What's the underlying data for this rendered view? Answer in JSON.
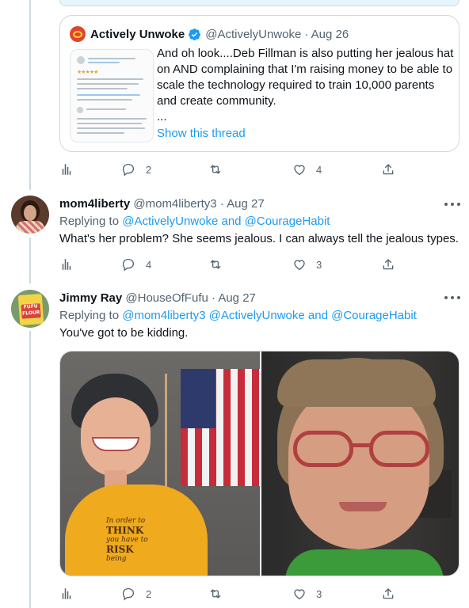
{
  "quoted": {
    "name": "Actively Unwoke",
    "handle": "@ActivelyUnwoke",
    "date": "· Aug 26",
    "text": "And oh look....Deb Fillman is also putting her jealous hat on AND complaining that I'm raising money to be able to scale the technology required to train 10,000 parents and create community.",
    "ellipsis": "...",
    "link": "Show this thread"
  },
  "top_actions": {
    "replies": "2",
    "retweets": "",
    "likes": "4"
  },
  "tweets": [
    {
      "name": "mom4liberty",
      "handle": "@mom4liberty3",
      "date": "· Aug 27",
      "replying_prefix": "Replying to",
      "replying_to": "@ActivelyUnwoke and @CourageHabit",
      "text": "What's her problem?  She seems jealous. I can always tell the jealous types.",
      "replies": "4",
      "likes": "3"
    },
    {
      "name": "Jimmy Ray",
      "handle": "@HouseOfFufu",
      "date": "· Aug 27",
      "replying_prefix": "Replying to",
      "replying_to": "@mom4liberty3 @ActivelyUnwoke and @CourageHabit",
      "text": "You've got to be kidding.",
      "replies": "2",
      "likes": "3"
    }
  ],
  "avatar_book": {
    "line1": "FUFU",
    "line2": "FLOUR"
  },
  "shirt_text": {
    "l1": "In order to",
    "l2": "THINK",
    "l3": "you have to",
    "l4": "RISK",
    "l5": "being"
  },
  "colors": {
    "accent": "#1d9bf0",
    "secondary_text": "#536471",
    "border": "#cfd9de"
  },
  "icons": [
    "analytics-icon",
    "reply-icon",
    "retweet-icon",
    "like-icon",
    "share-icon",
    "verified-badge-icon",
    "more-icon"
  ]
}
